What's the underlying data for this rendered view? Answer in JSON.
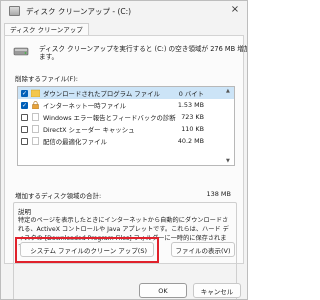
{
  "window": {
    "title": "ディスク クリーンアップ - (C:)",
    "close_icon": "×"
  },
  "tabs": [
    {
      "label": "ディスク クリーンアップ"
    }
  ],
  "intro": {
    "text": "ディスク クリーンアップを実行すると (C:) の空き領域が 276 MB 増加し",
    "text2": "ます。"
  },
  "file_section": {
    "label": "削除するファイル(F):",
    "items": [
      {
        "label": "ダウンロードされたプログラム ファイル",
        "size": "0 バイト",
        "checked": true,
        "selected": true
      },
      {
        "label": "インターネット一時ファイル",
        "size": "1.53 MB",
        "checked": true,
        "selected": false
      },
      {
        "label": "Windows エラー報告とフィードバックの診断",
        "size": "723 KB",
        "checked": false,
        "selected": false
      },
      {
        "label": "DirectX シェーダー キャッシュ",
        "size": "110 KB",
        "checked": false,
        "selected": false
      },
      {
        "label": "配信の最適化ファイル",
        "size": "40.2 MB",
        "checked": false,
        "selected": false
      }
    ]
  },
  "total": {
    "label": "増加するディスク領域の合計:",
    "value": "138 MB"
  },
  "description": {
    "title": "説明",
    "text": "特定のページを表示したときにインターネットから自動的にダウンロードされる、ActiveX コントロールや Java アプレットです。これらは、ハード ディスクの [Downloaded Program Files] フォルダーに一時的に保存されます。"
  },
  "buttons": {
    "cleanup_system": "システム ファイルのクリーン アップ(S)",
    "view_files": "ファイルの表示(V)",
    "ok": "OK",
    "cancel": "キャンセル"
  },
  "colors": {
    "highlight": "#e0212b",
    "accent": "#005fb8",
    "selected_row": "#cce4f7"
  }
}
